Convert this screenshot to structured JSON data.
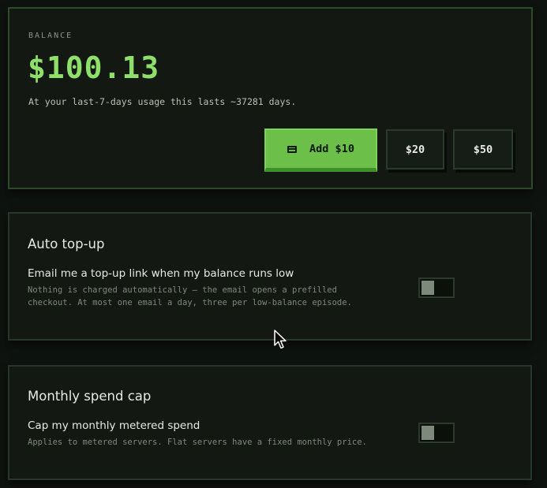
{
  "balance": {
    "label": "BALANCE",
    "amount": "$100.13",
    "note": "At your last-7-days usage this lasts ~37281 days.",
    "buttons": {
      "add_label": "Add $10",
      "add_icon": "credit-card-icon",
      "option_20": "$20",
      "option_50": "$50"
    }
  },
  "auto_topup": {
    "title": "Auto top-up",
    "setting_label": "Email me a top-up link when my balance runs low",
    "setting_desc": "Nothing is charged automatically — the email opens a prefilled\ncheckout. At most one email a day, three per low-balance episode.",
    "toggle_on": false
  },
  "spend_cap": {
    "title": "Monthly spend cap",
    "setting_label": "Cap my monthly metered spend",
    "setting_desc": "Applies to metered servers. Flat servers have a fixed monthly price.",
    "toggle_on": false
  },
  "colors": {
    "accent": "#6cc04a",
    "balance_text": "#8ee06a",
    "background": "#0f130f",
    "card": "#131912"
  }
}
